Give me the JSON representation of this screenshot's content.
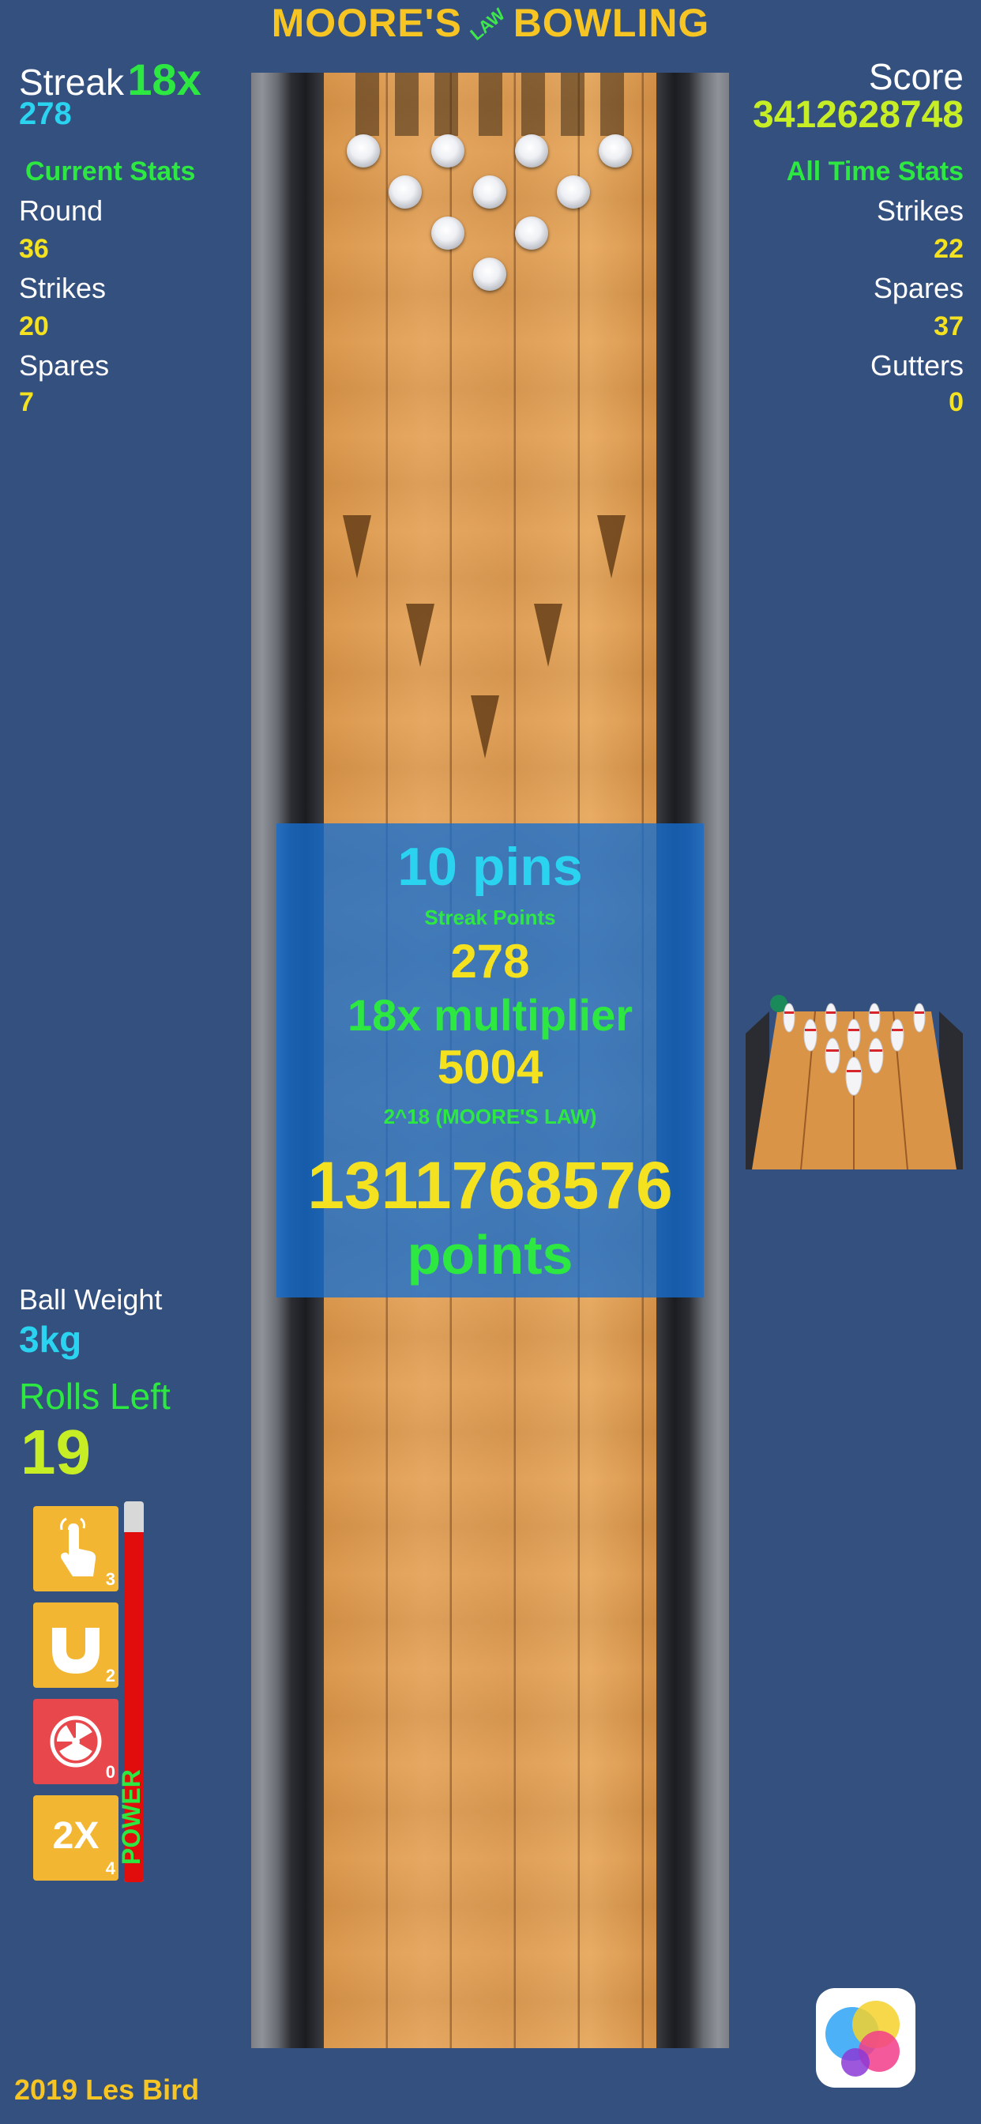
{
  "title": {
    "left": "MOORE'S",
    "law": "LAW",
    "right": "BOWLING"
  },
  "left_panel": {
    "streak_label": "Streak",
    "streak_multiplier": "18x",
    "streak_points": "278",
    "current_stats_header": "Current Stats",
    "round_label": "Round",
    "round_value": "36",
    "strikes_label": "Strikes",
    "strikes_value": "20",
    "spares_label": "Spares",
    "spares_value": "7",
    "ball_weight_label": "Ball Weight",
    "ball_weight_value": "3kg",
    "rolls_left_label": "Rolls Left",
    "rolls_left_value": "19"
  },
  "right_panel": {
    "score_label": "Score",
    "score_value": "3412628748",
    "all_time_header": "All Time Stats",
    "strikes_label": "Strikes",
    "strikes_value": "22",
    "spares_label": "Spares",
    "spares_value": "37",
    "gutters_label": "Gutters",
    "gutters_value": "0"
  },
  "overlay": {
    "pins": "10 pins",
    "streak_points_label": "Streak Points",
    "streak_points": "278",
    "multiplier": "18x multiplier",
    "multiplied": "5004",
    "moores_law": "2^18 (MOORE'S LAW)",
    "total": "1311768576",
    "points_label": "points"
  },
  "powerups": [
    {
      "name": "tap",
      "icon": "hand-pointer-icon",
      "count": "3"
    },
    {
      "name": "magnet",
      "icon": "magnet-icon",
      "count": "2"
    },
    {
      "name": "nuke",
      "icon": "radiation-icon",
      "count": "0"
    },
    {
      "name": "double",
      "label": "2X",
      "count": "4"
    }
  ],
  "power": {
    "label": "POWER",
    "level": 0.92
  },
  "footer": {
    "copyright": "2019 Les Bird"
  },
  "colors": {
    "background": "#33507e",
    "title_yellow": "#f6c523",
    "stat_yellow": "#f4e11f",
    "accent_green": "#2ee842",
    "accent_cyan": "#2ad4f0",
    "powerup_orange": "#f2b632",
    "powerup_red": "#e8474c",
    "power_red": "#e10d0d"
  }
}
